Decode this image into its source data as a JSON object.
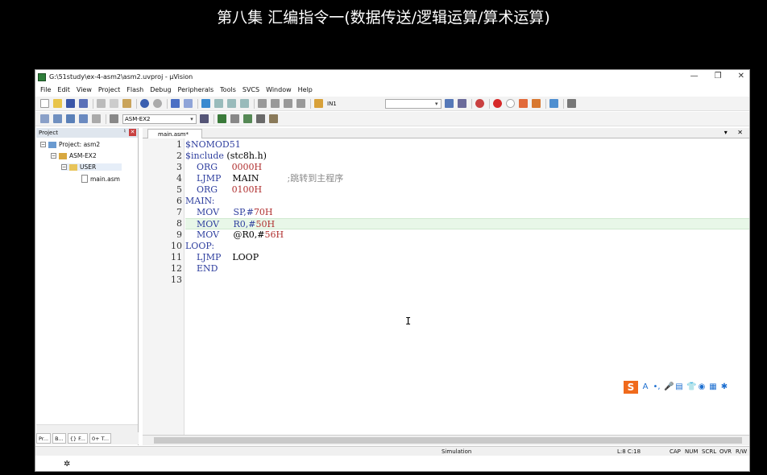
{
  "caption": "第八集 汇编指令一(数据传送/逻辑运算/算术运算)",
  "window": {
    "title": "G:\\51study\\ex-4-asm2\\asm2.uvproj - µVision",
    "controls": [
      "—",
      "❐",
      "✕"
    ]
  },
  "menu": [
    "File",
    "Edit",
    "View",
    "Project",
    "Flash",
    "Debug",
    "Peripherals",
    "Tools",
    "SVCS",
    "Window",
    "Help"
  ],
  "toolbar": {
    "find_label": "IN1",
    "target_select": "ASM-EX2"
  },
  "project_pane": {
    "header": "Project",
    "pin": "♮",
    "close": "✕",
    "tree": [
      {
        "label": "Project: asm2",
        "toggle": "−"
      },
      {
        "label": "ASM-EX2",
        "toggle": "−"
      },
      {
        "label": "USER",
        "toggle": "−"
      },
      {
        "label": "main.asm",
        "toggle": ""
      }
    ],
    "tabs": [
      "Pr...",
      "B...",
      "{} F...",
      "0+ T..."
    ]
  },
  "editor": {
    "tab_label": "main.asm*",
    "tab_controls": "▾ ✕",
    "lines": [
      {
        "n": "1",
        "parts": [
          {
            "t": "$NOMOD51",
            "c": "kw"
          }
        ]
      },
      {
        "n": "2",
        "parts": [
          {
            "t": "$include",
            "c": "kw"
          },
          {
            "t": " (stc8h.h)",
            "c": ""
          }
        ]
      },
      {
        "n": "3",
        "parts": [
          {
            "t": "    ORG",
            "c": "kw"
          },
          {
            "t": "     ",
            "c": ""
          },
          {
            "t": "0000H",
            "c": "num"
          }
        ]
      },
      {
        "n": "4",
        "parts": [
          {
            "t": "    LJMP",
            "c": "kw"
          },
          {
            "t": "    MAIN          ",
            "c": ""
          },
          {
            "t": ";跳转到主程序",
            "c": "cm"
          }
        ]
      },
      {
        "n": "5",
        "parts": [
          {
            "t": "    ORG",
            "c": "kw"
          },
          {
            "t": "     ",
            "c": ""
          },
          {
            "t": "0100H",
            "c": "num"
          }
        ]
      },
      {
        "n": "6",
        "parts": [
          {
            "t": "MAIN:",
            "c": "kw"
          }
        ]
      },
      {
        "n": "7",
        "parts": [
          {
            "t": "    MOV",
            "c": "kw"
          },
          {
            "t": "     SP,#",
            "c": "kw"
          },
          {
            "t": "70H",
            "c": "num"
          }
        ]
      },
      {
        "n": "8",
        "parts": [
          {
            "t": "    MOV",
            "c": "kw"
          },
          {
            "t": "     R0,#",
            "c": "kw"
          },
          {
            "t": "50H",
            "c": "num"
          }
        ]
      },
      {
        "n": "9",
        "parts": [
          {
            "t": "    MOV",
            "c": "kw"
          },
          {
            "t": "     @R0,#",
            "c": ""
          },
          {
            "t": "56H",
            "c": "num"
          }
        ]
      },
      {
        "n": "10",
        "parts": [
          {
            "t": "LOOP:",
            "c": "kw"
          }
        ]
      },
      {
        "n": "11",
        "parts": [
          {
            "t": "    LJMP",
            "c": "kw"
          },
          {
            "t": "    LOOP",
            "c": ""
          }
        ]
      },
      {
        "n": "12",
        "parts": [
          {
            "t": "    END",
            "c": "kw"
          }
        ]
      },
      {
        "n": "13",
        "parts": []
      }
    ],
    "highlighted_line": 8
  },
  "ime_toolbar": {
    "logo": "S",
    "icons": [
      "A",
      "•,",
      "🎤",
      "▤",
      "👕",
      "◉",
      "▦",
      "✱"
    ]
  },
  "statusbar": {
    "mode": "Simulation",
    "position": "L:8 C:18",
    "indicators": [
      "CAP",
      "NUM",
      "SCRL",
      "OVR",
      "R/W"
    ]
  },
  "colors": {
    "keyword": "#2f3f9f",
    "number": "#b03030",
    "comment": "#8a8a8a",
    "highlight": "#e8f7e8"
  }
}
